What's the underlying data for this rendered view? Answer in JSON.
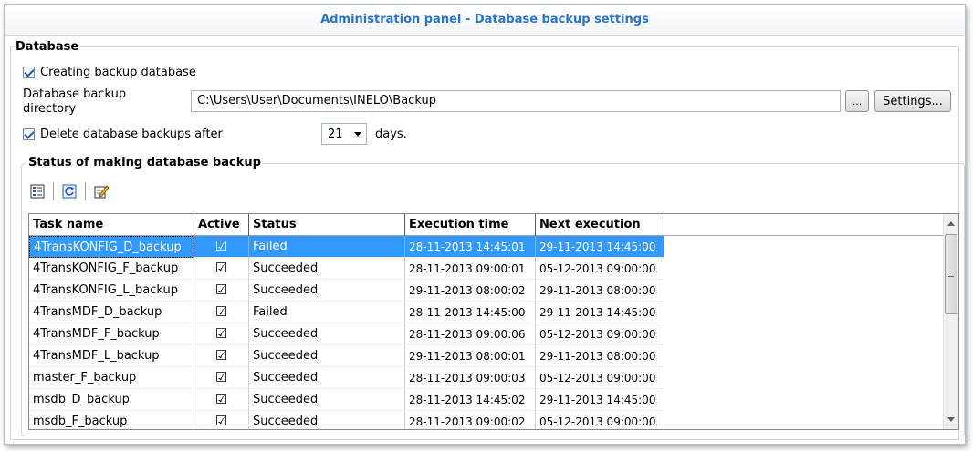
{
  "window": {
    "title": "Administration panel - Database backup settings"
  },
  "database_group": {
    "label": "Database",
    "create_backup": {
      "label": "Creating backup database",
      "checked": true
    },
    "directory_label": "Database backup directory",
    "directory_label_line1": "Database backup",
    "directory_label_line2": "directory",
    "directory_value": "C:\\Users\\User\\Documents\\INELO\\Backup",
    "browse_button": "...",
    "settings_button": "Settings...",
    "delete_after": {
      "label": "Delete database backups after",
      "checked": true
    },
    "days_value": "21",
    "days_unit": "days."
  },
  "status_group": {
    "label": "Status of making database backup",
    "toolbar_icons": [
      "list-icon",
      "refresh-icon",
      "edit-icon"
    ],
    "columns": [
      "Task name",
      "Active",
      "Status",
      "Execution time",
      "Next execution"
    ],
    "rows": [
      {
        "task": "4TransKONFIG_D_backup",
        "active": "☑",
        "status": "Failed",
        "exec": "28-11-2013 14:45:01",
        "next": "29-11-2013 14:45:00"
      },
      {
        "task": "4TransKONFIG_F_backup",
        "active": "☑",
        "status": "Succeeded",
        "exec": "28-11-2013 09:00:01",
        "next": "05-12-2013 09:00:00"
      },
      {
        "task": "4TransKONFIG_L_backup",
        "active": "☑",
        "status": "Succeeded",
        "exec": "29-11-2013 08:00:02",
        "next": "29-11-2013 08:00:00"
      },
      {
        "task": "4TransMDF_D_backup",
        "active": "☑",
        "status": "Failed",
        "exec": "28-11-2013 14:45:00",
        "next": "29-11-2013 14:45:00"
      },
      {
        "task": "4TransMDF_F_backup",
        "active": "☑",
        "status": "Succeeded",
        "exec": "28-11-2013 09:00:06",
        "next": "05-12-2013 09:00:00"
      },
      {
        "task": "4TransMDF_L_backup",
        "active": "☑",
        "status": "Succeeded",
        "exec": "29-11-2013 08:00:01",
        "next": "29-11-2013 08:00:00"
      },
      {
        "task": "master_F_backup",
        "active": "☑",
        "status": "Succeeded",
        "exec": "28-11-2013 09:00:03",
        "next": "05-12-2013 09:00:00"
      },
      {
        "task": "msdb_D_backup",
        "active": "☑",
        "status": "Succeeded",
        "exec": "28-11-2013 14:45:02",
        "next": "29-11-2013 14:45:00"
      },
      {
        "task": "msdb_F_backup",
        "active": "☑",
        "status": "Succeeded",
        "exec": "28-11-2013 09:00:02",
        "next": "05-12-2013 09:00:00"
      }
    ],
    "selected_row_index": 0
  },
  "colors": {
    "title": "#2a73c8",
    "selection": "#3399ff"
  }
}
